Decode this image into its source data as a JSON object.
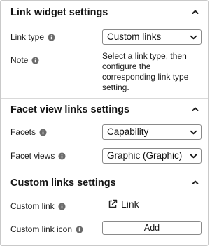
{
  "link_widget": {
    "title": "Link widget settings",
    "link_type_label": "Link type",
    "link_type_value": "Custom links",
    "note_label": "Note",
    "note_text": "Select a link type, then configure the corresponding link type setting."
  },
  "facet_view": {
    "title": "Facet view links settings",
    "facets_label": "Facets",
    "facets_value": "Capability",
    "facet_views_label": "Facet views",
    "facet_views_value": "Graphic (Graphic)"
  },
  "custom_links": {
    "title": "Custom links settings",
    "custom_link_label": "Custom link",
    "custom_link_text": "Link",
    "custom_link_icon_label": "Custom link icon",
    "add_label": "Add"
  },
  "icons": {
    "section_toggle": "chevron-up-icon",
    "info": "info-icon",
    "dropdown": "chevron-down-icon",
    "external_link": "external-link-icon"
  }
}
